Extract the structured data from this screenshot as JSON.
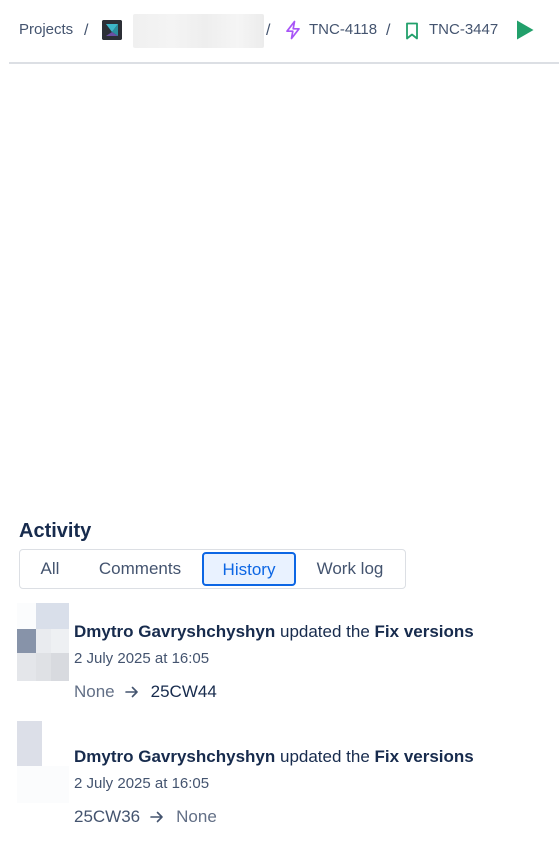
{
  "breadcrumb": {
    "projects_label": "Projects",
    "separator": "/",
    "epic_key": "TNC-4118",
    "story_key": "TNC-3447"
  },
  "colors": {
    "epic_icon": "#a855f7",
    "story_icon": "#22a06b",
    "play_icon": "#22a06b",
    "tab_active_border": "#0c66e4",
    "tab_active_bg": "#e9f2ff"
  },
  "activity": {
    "title": "Activity",
    "tabs": [
      {
        "label": "All",
        "active": false
      },
      {
        "label": "Comments",
        "active": false
      },
      {
        "label": "History",
        "active": true
      },
      {
        "label": "Work log",
        "active": false
      }
    ],
    "entries": [
      {
        "author": "Dmytro Gavryshchyshyn",
        "verb": "updated the",
        "field": "Fix versions",
        "date": "2 July 2025 at 16:05",
        "from": "None",
        "to": "25CW44"
      },
      {
        "author": "Dmytro Gavryshchyshyn",
        "verb": "updated the",
        "field": "Fix versions",
        "date": "2 July 2025 at 16:05",
        "from": "25CW36",
        "to": "None"
      }
    ]
  }
}
